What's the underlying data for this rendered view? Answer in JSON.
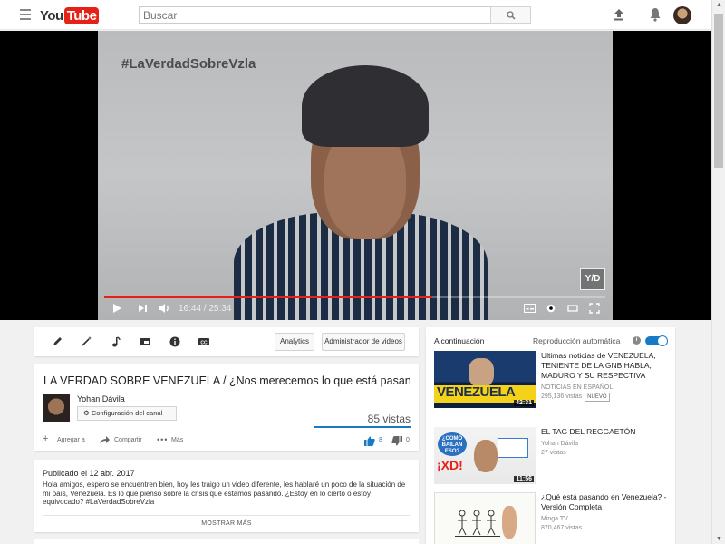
{
  "header": {
    "logo_you": "You",
    "logo_tube": "Tube",
    "search_placeholder": "Buscar"
  },
  "player": {
    "overlay_hashtag": "#LaVerdadSobreVzla",
    "watermark": "Y/D",
    "time": "16:44 / 25:34",
    "progress_fraction": 0.6545,
    "buffered_fraction": 0.65
  },
  "toolbar": {
    "analytics_label": "Analytics",
    "video_manager_label": "Administrador de videos"
  },
  "video": {
    "title": "LA VERDAD SOBRE VENEZUELA / ¿Nos merecemos lo que está pasando?",
    "channel_name": "Yohan Dávila",
    "channel_config_label": "Configuración del canal",
    "views": "85 vistas",
    "add_label": "Agregar a",
    "share_label": "Compartir",
    "more_label": "Más",
    "likes": "8",
    "dislikes": "0"
  },
  "description": {
    "published": "Publicado el 12 abr. 2017",
    "text": "Hola amigos, espero se encuentren bien, hoy les traigo un video diferente, les hablaré un poco de la situación de mi país, Venezuela. Es lo que pienso sobre la crisis que estamos pasando. ¿Estoy en lo cierto o estoy equivocado? #LaVerdadSobreVzla",
    "show_more": "MOSTRAR MÁS"
  },
  "sidebar": {
    "up_next": "A continuación",
    "autoplay_label": "Reproducción automática",
    "autoplay_on": true,
    "items": [
      {
        "title": "Ultimas noticias de VENEZUELA, TENIENTE DE LA GNB HABLA, MADURO Y SU RESPECTIVA",
        "channel": "NOTICIAS EN ESPAÑOL",
        "views": "295,136 vistas",
        "badge": "NUEVO",
        "duration": "42:31",
        "thumb_text": "VENEZUELA"
      },
      {
        "title": "EL TAG DEL REGGAETÓN",
        "channel": "Yohan Dávila",
        "views": "27 vistas",
        "duration": "11:56",
        "thumb_text": "¡XD!",
        "thumb_bubble": "¿COMO BAILAN ESO?"
      },
      {
        "title": "¿Qué está pasando en Venezuela? - Versión Completa",
        "channel": "Minga TV",
        "views": "870,467 vistas"
      }
    ]
  }
}
